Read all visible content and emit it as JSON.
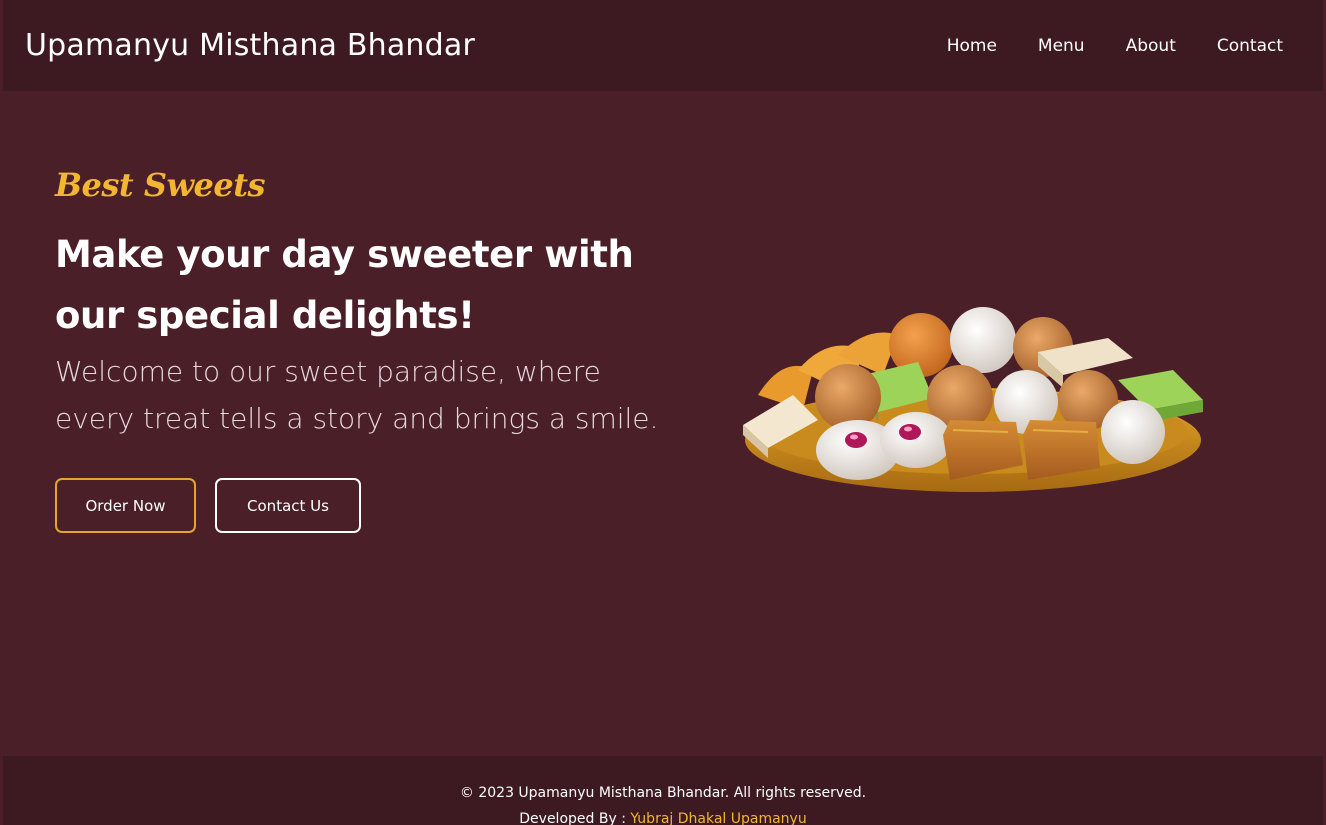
{
  "header": {
    "brand": "Upamanyu Misthana Bhandar",
    "nav": [
      "Home",
      "Menu",
      "About",
      "Contact"
    ]
  },
  "hero": {
    "tagline": "Best Sweets",
    "headline": "Make your day sweeter with our special delights!",
    "welcome": "Welcome to our sweet paradise, where every treat tells a story and brings a smile.",
    "order_button": "Order Now",
    "contact_button": "Contact Us"
  },
  "footer": {
    "copyright": "© 2023 Upamanyu Misthana Bhandar. All rights reserved.",
    "developed_by_label": "Developed By : ",
    "developer": "Yubraj Dhakal Upamanyu"
  },
  "colors": {
    "background": "#4a1f28",
    "header_footer": "#3d1a21",
    "accent": "#f2b632"
  }
}
